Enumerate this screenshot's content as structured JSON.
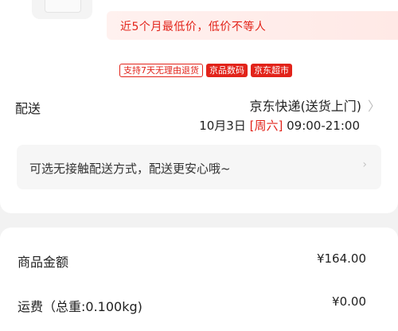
{
  "promo": {
    "price_note": "近5个月最低价，低价不等人"
  },
  "tags": [
    {
      "label": "支持7天无理由退货",
      "style": "outline"
    },
    {
      "label": "京品数码",
      "style": "red"
    },
    {
      "label": "京东超市",
      "style": "red"
    }
  ],
  "delivery": {
    "label": "配送",
    "method": "京东快递(送货上门)",
    "date": "10月3日",
    "weekday": "[周六]",
    "time_range": "09:00-21:00",
    "chevron_icon": "chevron-right-icon"
  },
  "contactless": {
    "text": "可选无接触配送方式，配送更安心哦~",
    "chevron_icon": "chevron-right-icon"
  },
  "summary": {
    "rows": [
      {
        "label": "商品金额",
        "value": "¥164.00"
      },
      {
        "label": "运费（总重:0.100kg)",
        "value": "¥0.00"
      }
    ]
  },
  "colors": {
    "accent_red": "#e2231a",
    "page_bg": "#f2f2f2",
    "card_bg": "#ffffff"
  }
}
